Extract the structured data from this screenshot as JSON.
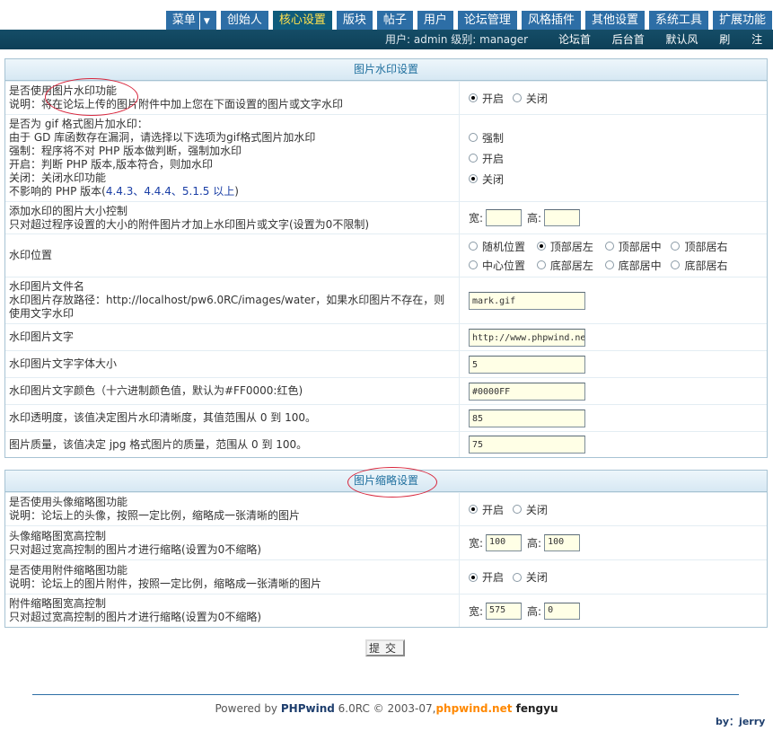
{
  "nav": {
    "tabs": [
      "菜单",
      "创始人",
      "核心设置",
      "版块",
      "帖子",
      "用户",
      "论坛管理",
      "风格插件",
      "其他设置",
      "系统工具",
      "扩展功能"
    ],
    "active_index": 2
  },
  "infobar": {
    "user_text": "用户: admin 级别: manager",
    "links": [
      "论坛首页",
      "后台首页",
      "默认风格",
      "刷新",
      "注销"
    ]
  },
  "watermark": {
    "title": "图片水印设置",
    "enable": {
      "label": "是否使用图片水印功能",
      "desc": "说明：将在论坛上传的图片附件中加上您在下面设置的图片或文字水印",
      "options": [
        "开启",
        "关闭"
      ],
      "selected": "开启"
    },
    "gif": {
      "label": "是否为 gif 格式图片加水印：",
      "desc1": "由于 GD 库函数存在漏洞，请选择以下选项为gif格式图片加水印",
      "desc2": "强制：程序将不对 PHP 版本做判断，强制加水印",
      "desc3": "开启：判断 PHP 版本,版本符合，则加水印",
      "desc4": "关闭：关闭水印功能",
      "desc5_prefix": "不影响的 PHP 版本(",
      "versions": "4.4.3、4.4.4、5.1.5 以上",
      "desc5_suffix": ")",
      "options": [
        "强制",
        "开启",
        "关闭"
      ],
      "selected": "关闭"
    },
    "size": {
      "label": "添加水印的图片大小控制",
      "desc": "只对超过程序设置的大小的附件图片才加上水印图片或文字(设置为0不限制)",
      "width_label": "宽:",
      "height_label": "高:",
      "width": "",
      "height": ""
    },
    "position": {
      "label": "水印位置",
      "options": [
        "随机位置",
        "顶部居左",
        "顶部居中",
        "顶部居右",
        "中心位置",
        "底部居左",
        "底部居中",
        "底部居右"
      ],
      "selected": "顶部居左"
    },
    "file": {
      "label": "水印图片文件名",
      "desc": "水印图片存放路径：http://localhost/pw6.0RC/images/water，如果水印图片不存在，则使用文字水印",
      "value": "mark.gif"
    },
    "text": {
      "label": "水印图片文字",
      "value": "http://www.phpwind.ne"
    },
    "font_size": {
      "label": "水印图片文字字体大小",
      "value": "5"
    },
    "color": {
      "label": "水印图片文字颜色（十六进制颜色值，默认为#FF0000:红色)",
      "value": "#0000FF"
    },
    "opacity": {
      "label": "水印透明度，该值决定图片水印清晰度，其值范围从 0 到 100。",
      "value": "85"
    },
    "quality": {
      "label": "图片质量，该值决定 jpg 格式图片的质量，范围从 0 到 100。",
      "value": "75"
    }
  },
  "thumb": {
    "title": "图片缩略设置",
    "avatar_enable": {
      "label": "是否使用头像缩略图功能",
      "desc": "说明：论坛上的头像，按照一定比例，缩略成一张清晰的图片",
      "options": [
        "开启",
        "关闭"
      ],
      "selected": "开启"
    },
    "avatar_size": {
      "label": "头像缩略图宽高控制",
      "desc": "只对超过宽高控制的图片才进行缩略(设置为0不缩略)",
      "width_label": "宽:",
      "height_label": "高:",
      "width": "100",
      "height": "100"
    },
    "attach_enable": {
      "label": "是否使用附件缩略图功能",
      "desc": "说明：论坛上的图片附件，按照一定比例，缩略成一张清晰的图片",
      "options": [
        "开启",
        "关闭"
      ],
      "selected": "开启"
    },
    "attach_size": {
      "label": "附件缩略图宽高控制",
      "desc": "只对超过宽高控制的图片才进行缩略(设置为0不缩略)",
      "width_label": "宽:",
      "height_label": "高:",
      "width": "575",
      "height": "0"
    }
  },
  "submit_label": "提交",
  "footer": {
    "powered": "Powered by ",
    "brand": "PHPwind",
    "version": " 6.0RC © 2003-07,",
    "site": "phpwind.net",
    "author": " fengyu"
  },
  "byline": "by：jerry"
}
